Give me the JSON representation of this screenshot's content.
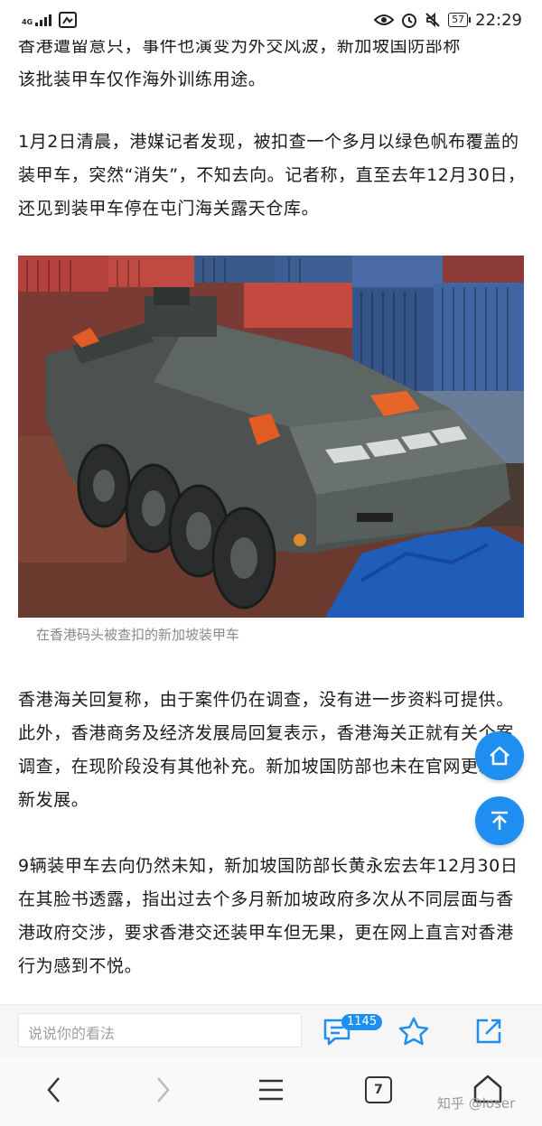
{
  "status": {
    "network": "4G",
    "battery": "57",
    "time": "22:29"
  },
  "article": {
    "p1_line1": "香港遭留意只，事件也演变为外交风波，新加坡国防部称",
    "p1_line2": "该批装甲车仅作海外训练用途。",
    "p2": "1月2日清晨，港媒记者发现，被扣查一个多月以绿色帆布覆盖的装甲车，突然“消失”，不知去向。记者称，直至去年12月30日，还见到装甲车停在屯门海关露天仓库。",
    "caption": "在香港码头被查扣的新加坡装甲车",
    "p3": "香港海关回复称，由于案件仍在调查，没有进一步资料可提供。此外，香港商务及经济发展局回复表示，香港海关正就有关个案调查，在现阶段没有其他补充。新加坡国防部也未在官网更新最新发展。",
    "p4": "9辆装甲车去向仍然未知，新加坡国防部长黄永宏去年12月30日在其脸书透露，指出过去个多月新加坡政府多次从不同层面与香港政府交涉，要求香港交还装甲车但无果，更在网上直言对香港行为感到不悦。"
  },
  "comment_bar": {
    "placeholder": "说说你的看法",
    "comment_count": "1145"
  },
  "nav": {
    "tab_count": "7"
  },
  "watermark": "知乎 @loser",
  "colors": {
    "accent": "#1e8ef0"
  }
}
